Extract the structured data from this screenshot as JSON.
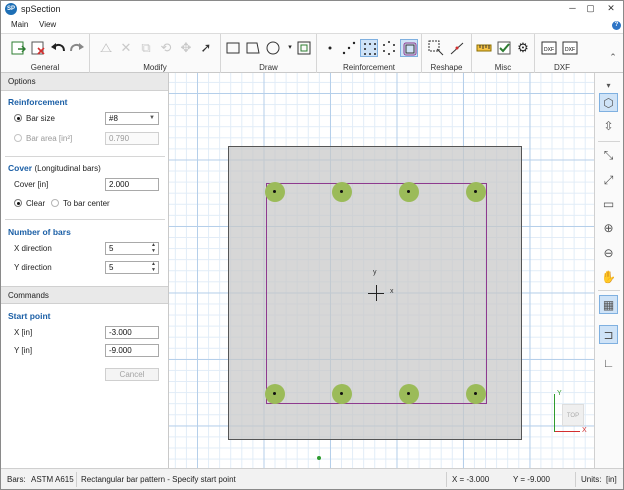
{
  "app": {
    "logo_text": "SP",
    "title": "spSection"
  },
  "window_controls": {
    "minimize": "─",
    "maximize": "▢",
    "close": "✕"
  },
  "menu": {
    "tabs": [
      "Main",
      "View"
    ]
  },
  "ribbon": {
    "groups": [
      "General",
      "Modify",
      "Draw",
      "Reinforcement",
      "Reshape",
      "Misc",
      "DXF"
    ]
  },
  "options": {
    "header": "Options",
    "reinforcement": {
      "title": "Reinforcement",
      "bar_size_label": "Bar size",
      "bar_size_value": "#8",
      "bar_area_label": "Bar area [in²]",
      "bar_area_value": "0.790"
    },
    "cover": {
      "title": "Cover",
      "subtitle": "(Longitudinal bars)",
      "cover_label": "Cover [in]",
      "cover_value": "2.000",
      "clear_label": "Clear",
      "to_center_label": "To bar center"
    },
    "number_of_bars": {
      "title": "Number of bars",
      "x_label": "X direction",
      "x_value": "5",
      "y_label": "Y direction",
      "y_value": "5"
    }
  },
  "commands": {
    "header": "Commands",
    "start_point": {
      "title": "Start point",
      "x_label": "X [in]",
      "x_value": "-3.000",
      "y_label": "Y [in]",
      "y_value": "-9.000",
      "cancel_label": "Cancel"
    }
  },
  "canvas": {
    "origin_x_label": "x",
    "origin_y_label": "y",
    "cube_label": "TOP",
    "triad_x": "X",
    "triad_y": "Y"
  },
  "status": {
    "bars": "Bars:",
    "bars_standard": "ASTM A615",
    "message": "Rectangular bar pattern - Specify start point",
    "x": "X = -3.000",
    "y": "Y = -9.000",
    "units_label": "Units:",
    "units_value": "[in]"
  },
  "colors": {
    "accent": "#1b5fa6",
    "rebar": "#9bbb59",
    "bar_layout": "#8e3a8e",
    "grid_major": "#b5cfea",
    "concrete": "#c8c8c8"
  },
  "icons": {
    "ribbon": [
      "new-file-icon",
      "close-file-icon",
      "undo-icon",
      "redo-icon",
      "mirror-icon",
      "delete-icon",
      "copy-icon",
      "rotate-icon",
      "move-icon",
      "select-icon",
      "rectangle-icon",
      "polygon-icon",
      "circle-icon",
      "shape-icon",
      "single-bar-icon",
      "line-bars-icon",
      "rectangular-bars-icon",
      "circular-bars-icon",
      "offset-bars-icon",
      "reshape-select-icon",
      "reshape-node-icon",
      "measure-icon",
      "check-icon",
      "settings-icon",
      "dxf-import-icon",
      "dxf-export-icon"
    ],
    "right_toolbar": [
      "view-3d-icon",
      "view-plan-icon",
      "zoom-extents-icon",
      "zoom-window-icon",
      "zoom-selection-icon",
      "zoom-in-icon",
      "zoom-out-icon",
      "pan-icon",
      "grid-icon",
      "snap-icon",
      "axes-icon"
    ]
  }
}
